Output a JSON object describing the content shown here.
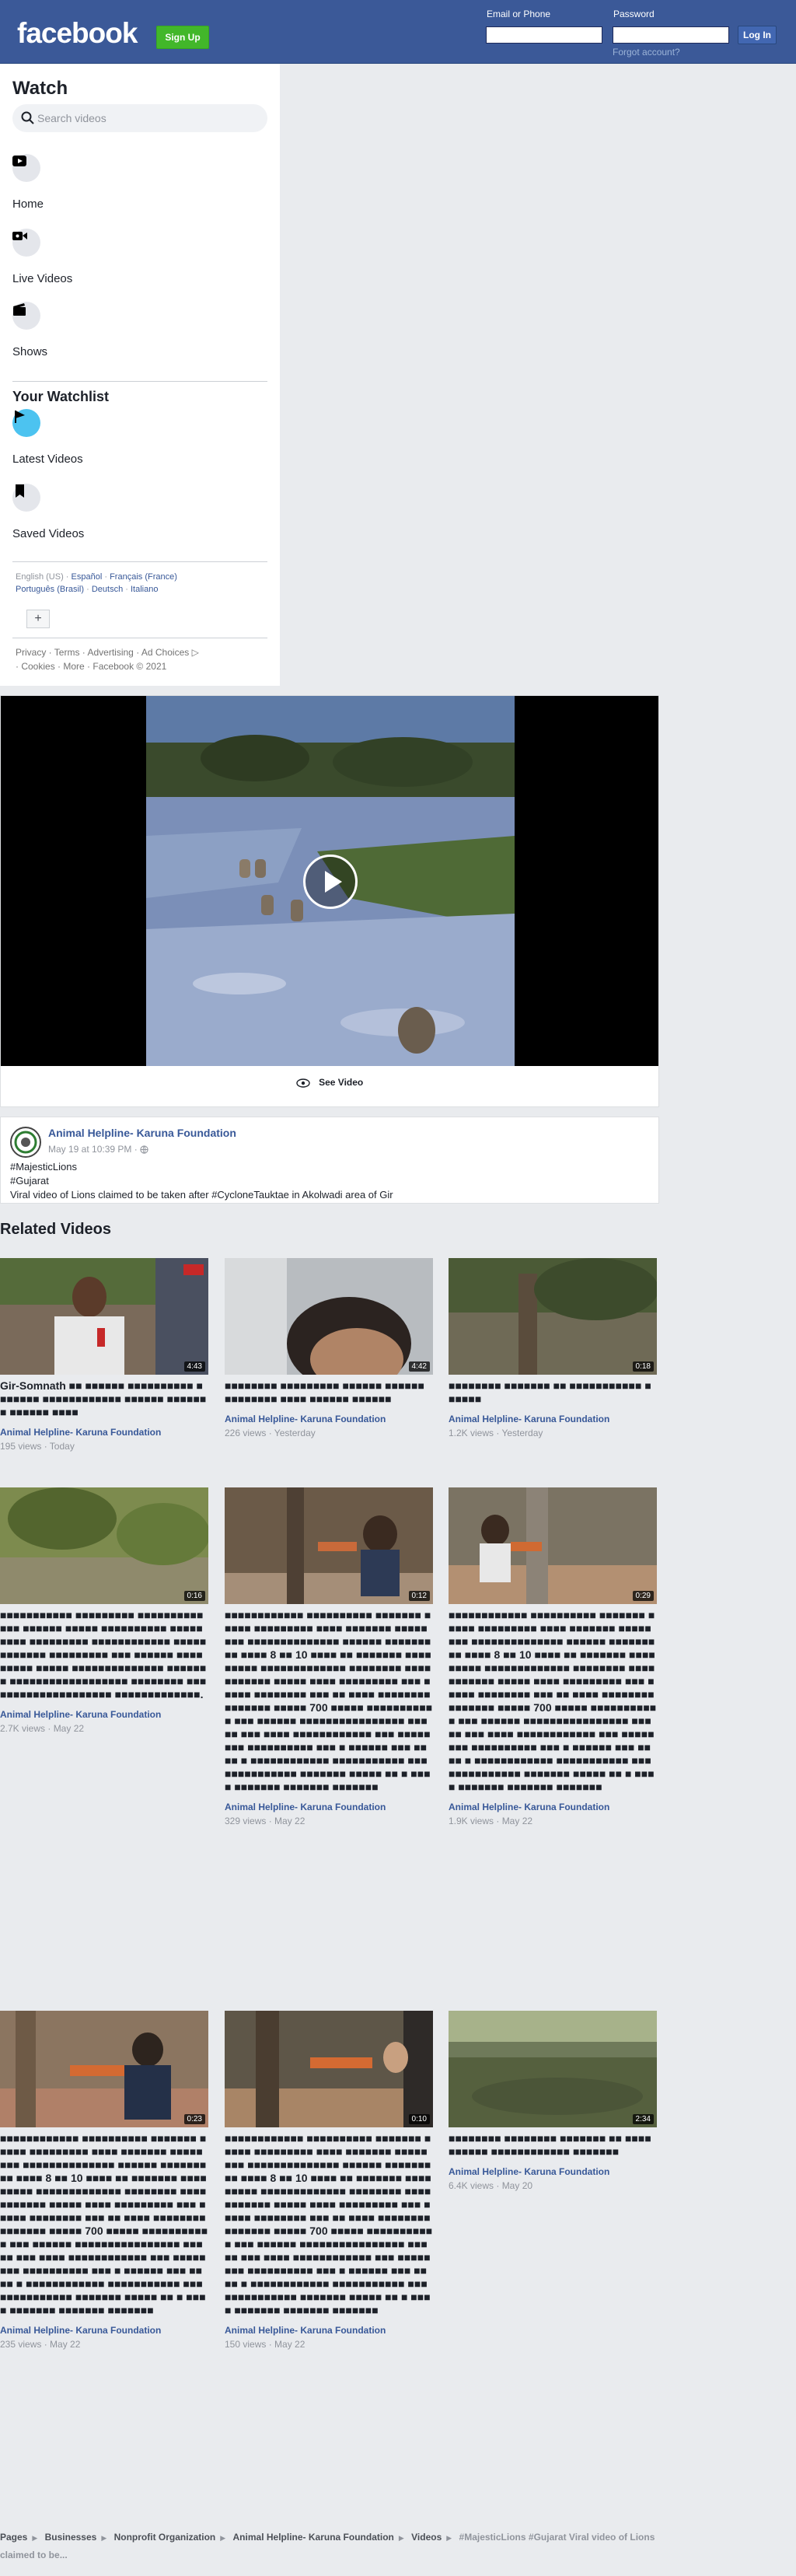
{
  "header": {
    "logo": "facebook",
    "signup_label": "Sign Up",
    "email_label": "Email or Phone",
    "password_label": "Password",
    "login_label": "Log In",
    "forgot_label": "Forgot account?"
  },
  "sidebar": {
    "title": "Watch",
    "search_placeholder": "Search videos",
    "nav": [
      {
        "label": "Home",
        "icon": "play-screen-icon"
      },
      {
        "label": "Live Videos",
        "icon": "live-camera-icon"
      },
      {
        "label": "Shows",
        "icon": "clapperboard-icon"
      }
    ],
    "watchlist_title": "Your Watchlist",
    "watchlist": [
      {
        "label": "Latest Videos",
        "icon": "flag-icon",
        "accent": "#4cc3f0"
      },
      {
        "label": "Saved Videos",
        "icon": "bookmark-icon"
      }
    ],
    "languages": {
      "current": "English (US)",
      "others": [
        "Español",
        "Français (France)",
        "Português (Brasil)",
        "Deutsch",
        "Italiano"
      ]
    },
    "plus": "+",
    "footer": [
      "Privacy",
      "Terms",
      "Advertising",
      "Ad Choices",
      "Cookies",
      "More",
      "Facebook © 2021"
    ]
  },
  "video": {
    "see_video": "See Video"
  },
  "post": {
    "page_name": "Animal Helpline- Karuna Foundation",
    "time": "May 19 at 10:39 PM ·",
    "lines": [
      "#MajesticLions",
      "#Gujarat",
      "Viral video of Lions claimed to be taken after #CycloneTauktae in Akolwadi area of Gir"
    ]
  },
  "related": {
    "title": "Related Videos",
    "items": [
      {
        "duration": "4:43",
        "title": "Gir-Somnath ■■ ■■■■■■ ■■■■■■■■■■ ■■■■■■■ ■■■■■■■■■■■■ ■■■■■■ ■■■■■■■ ■■■■■■ ■■■■",
        "channel": "Animal Helpline- Karuna Foundation",
        "meta": "195 views · Today"
      },
      {
        "duration": "4:42",
        "title": "■■■■■■■■ ■■■■■■■■■ ■■■■■■ ■■■■■■ ■■■■■■■■ ■■■■ ■■■■■■ ■■■■■■",
        "channel": "Animal Helpline- Karuna Foundation",
        "meta": "226 views · Yesterday"
      },
      {
        "duration": "0:18",
        "title": "■■■■■■■■ ■■■■■■■ ■■ ■■■■■■■■■■■ ■■■■■■",
        "channel": "Animal Helpline- Karuna Foundation",
        "meta": "1.2K views · Yesterday"
      },
      {
        "duration": "0:16",
        "title": "■■■■■■■■■■■ ■■■■■■■■■ ■■■■■■■■■■■■■ ■■■■■■ ■■■■■ ■■■■■■■■■■ ■■■■■■■■■ ■■■■■■■■■ ■■■■■■■■■■■■ ■■■■■■■■■■■■ ■■■■■■■■■ ■■■ ■■■■■■ ■■■■ ■■■■■ ■■■■■ ■■■■■■■■■■■■■■ ■■■■■■■ ■■■■■■■■■■■■■■■■■■ ■■■■■■■■ ■■■■■■■■■■■■■■■■■■■■ ■■■■■■■■■■■■■.",
        "channel": "Animal Helpline- Karuna Foundation",
        "meta": "2.7K views · May 22"
      },
      {
        "duration": "0:12",
        "title": "■■■■■■■■■■■■ ■■■■■■■■■■ ■■■■■■■ ■■■■■ ■■■■■■■■■ ■■■■ ■■■■■■■ ■■■■■■■■ ■■■■■■■■■■■■■■ ■■■■■■ ■■■■■■■■■ ■■■■ 8 ■■ 10 ■■■■ ■■ ■■■■■■■ ■■■■■■■■■ ■■■■■■■■■■■■■ ■■■■■■■■ ■■■■ ■■■■■■■ ■■■■■ ■■■■ ■■■■■■■■■ ■■■ ■■■■■ ■■■■■■■■ ■■■ ■■ ■■■■ ■■■■■■■■ ■■■■■■■ ■■■■■ 700 ■■■■■ ■■■■■■■■■■■ ■■■ ■■■■■■ ■■■■■■■■■■■■■■■■ ■■■■■ ■■■ ■■■■ ■■■■■■■■■■■■ ■■■ ■■■■■■■■ ■■■■■■■■■■ ■■■ ■ ■■■■■■ ■■■ ■■■■ ■ ■■■■■■■■■■■■ ■■■■■■■■■■■ ■■■■■■■■■■■■■■ ■■■■■■■ ■■■■■ ■■ ■ ■■■■ ■■■■■■■ ■■■■■■■ ■■■■■■■",
        "channel": "Animal Helpline- Karuna Foundation",
        "meta": "329 views · May 22"
      },
      {
        "duration": "0:29",
        "title": "■■■■■■■■■■■■ ■■■■■■■■■■ ■■■■■■■ ■■■■■ ■■■■■■■■■ ■■■■ ■■■■■■■ ■■■■■■■■ ■■■■■■■■■■■■■■ ■■■■■■ ■■■■■■■■■ ■■■■ 8 ■■ 10 ■■■■ ■■ ■■■■■■■ ■■■■■■■■■ ■■■■■■■■■■■■■ ■■■■■■■■ ■■■■ ■■■■■■■ ■■■■■ ■■■■ ■■■■■■■■■ ■■■ ■■■■■ ■■■■■■■■ ■■■ ■■ ■■■■ ■■■■■■■■ ■■■■■■■ ■■■■■ 700 ■■■■■ ■■■■■■■■■■■ ■■■ ■■■■■■ ■■■■■■■■■■■■■■■■ ■■■■■ ■■■ ■■■■ ■■■■■■■■■■■■ ■■■ ■■■■■■■■ ■■■■■■■■■■ ■■■ ■ ■■■■■■ ■■■ ■■■■ ■ ■■■■■■■■■■■■ ■■■■■■■■■■■ ■■■■■■■■■■■■■■ ■■■■■■■ ■■■■■ ■■ ■ ■■■■ ■■■■■■■ ■■■■■■■ ■■■■■■■",
        "channel": "Animal Helpline- Karuna Foundation",
        "meta": "1.9K views · May 22"
      },
      {
        "duration": "0:23",
        "title": "■■■■■■■■■■■■ ■■■■■■■■■■ ■■■■■■■ ■■■■■ ■■■■■■■■■ ■■■■ ■■■■■■■ ■■■■■■■■ ■■■■■■■■■■■■■■ ■■■■■■ ■■■■■■■■■ ■■■■ 8 ■■ 10 ■■■■ ■■ ■■■■■■■ ■■■■■■■■■ ■■■■■■■■■■■■■ ■■■■■■■■ ■■■■ ■■■■■■■ ■■■■■ ■■■■ ■■■■■■■■■ ■■■ ■■■■■ ■■■■■■■■ ■■■ ■■ ■■■■ ■■■■■■■■ ■■■■■■■ ■■■■■ 700 ■■■■■ ■■■■■■■■■■■ ■■■ ■■■■■■ ■■■■■■■■■■■■■■■■ ■■■■■ ■■■ ■■■■ ■■■■■■■■■■■■ ■■■ ■■■■■■■■ ■■■■■■■■■■ ■■■ ■ ■■■■■■ ■■■ ■■■■ ■ ■■■■■■■■■■■■ ■■■■■■■■■■■ ■■■■■■■■■■■■■■ ■■■■■■■ ■■■■■ ■■ ■ ■■■■ ■■■■■■■ ■■■■■■■ ■■■■■■■",
        "channel": "Animal Helpline- Karuna Foundation",
        "meta": "235 views · May 22"
      },
      {
        "duration": "0:10",
        "title": "■■■■■■■■■■■■ ■■■■■■■■■■ ■■■■■■■ ■■■■■ ■■■■■■■■■ ■■■■ ■■■■■■■ ■■■■■■■■ ■■■■■■■■■■■■■■ ■■■■■■ ■■■■■■■■■ ■■■■ 8 ■■ 10 ■■■■ ■■ ■■■■■■■ ■■■■■■■■■ ■■■■■■■■■■■■■ ■■■■■■■■ ■■■■ ■■■■■■■ ■■■■■ ■■■■ ■■■■■■■■■ ■■■ ■■■■■ ■■■■■■■■ ■■■ ■■ ■■■■ ■■■■■■■■ ■■■■■■■ ■■■■■ 700 ■■■■■ ■■■■■■■■■■■ ■■■ ■■■■■■ ■■■■■■■■■■■■■■■■ ■■■■■ ■■■ ■■■■ ■■■■■■■■■■■■ ■■■ ■■■■■■■■ ■■■■■■■■■■ ■■■ ■ ■■■■■■ ■■■ ■■■■ ■ ■■■■■■■■■■■■ ■■■■■■■■■■■ ■■■■■■■■■■■■■■ ■■■■■■■ ■■■■■ ■■ ■ ■■■■ ■■■■■■■ ■■■■■■■ ■■■■■■■",
        "channel": "Animal Helpline- Karuna Foundation",
        "meta": "150 views · May 22"
      },
      {
        "duration": "2:34",
        "title": "■■■■■■■■ ■■■■■■■■ ■■■■■■■ ■■ ■■■■■■■■■■ ■■■■■■■■■■■■ ■■■■■■■",
        "channel": "Animal Helpline- Karuna Foundation",
        "meta": "6.4K views · May 20"
      }
    ]
  },
  "breadcrumb": [
    "Pages",
    "Businesses",
    "Nonprofit Organization",
    "Animal Helpline- Karuna Foundation",
    "Videos",
    "#MajesticLions #Gujarat Viral video of Lions claimed to be..."
  ],
  "colors": {
    "brand": "#3b5998",
    "signup": "#42b72a",
    "link": "#385898"
  }
}
